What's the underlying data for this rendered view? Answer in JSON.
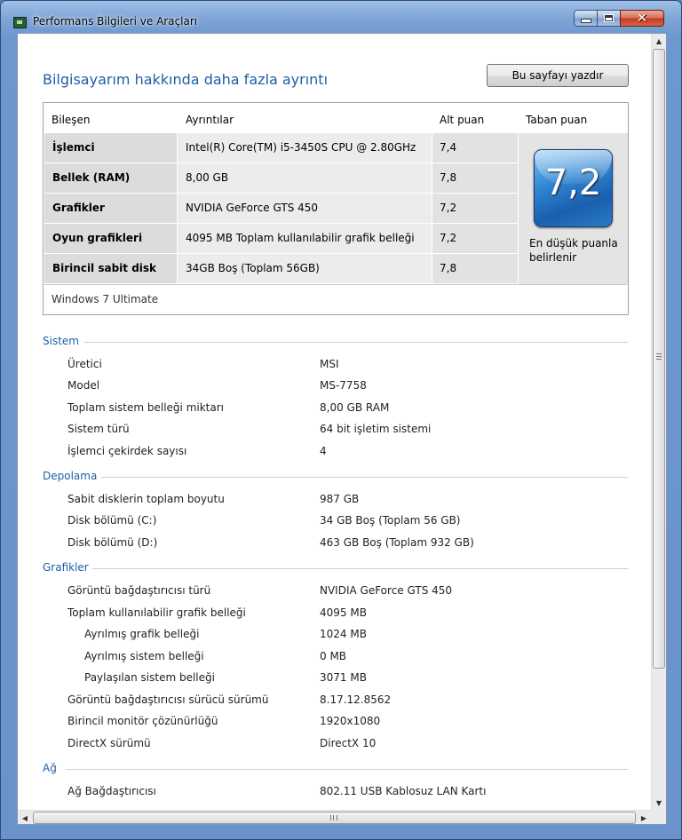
{
  "window": {
    "title": "Performans Bilgileri ve Araçları",
    "close_glyph": "✕"
  },
  "page": {
    "heading": "Bilgisayarım hakkında daha fazla ayrıntı",
    "print_button": "Bu sayfayı yazdır"
  },
  "scores": {
    "headers": {
      "component": "Bileşen",
      "details": "Ayrıntılar",
      "subscore": "Alt puan",
      "base": "Taban puan"
    },
    "rows": [
      {
        "component": "İşlemci",
        "details": "Intel(R) Core(TM) i5-3450S CPU @ 2.80GHz",
        "subscore": "7,4"
      },
      {
        "component": "Bellek (RAM)",
        "details": "8,00 GB",
        "subscore": "7,8"
      },
      {
        "component": "Grafikler",
        "details": "NVIDIA GeForce GTS 450",
        "subscore": "7,2"
      },
      {
        "component": "Oyun grafikleri",
        "details": "4095 MB Toplam kullanılabilir grafik belleği",
        "subscore": "7,2"
      },
      {
        "component": "Birincil sabit disk",
        "details": "34GB Boş (Toplam 56GB)",
        "subscore": "7,8"
      }
    ],
    "base_score": "7,2",
    "base_note": "En düşük puanla belirlenir",
    "os": "Windows 7 Ultimate"
  },
  "sections": {
    "system": {
      "title": "Sistem",
      "items": [
        {
          "label": "Üretici",
          "value": "MSI"
        },
        {
          "label": "Model",
          "value": "MS-7758"
        },
        {
          "label": "Toplam sistem belleği miktarı",
          "value": "8,00 GB RAM"
        },
        {
          "label": "Sistem türü",
          "value": "64 bit işletim sistemi"
        },
        {
          "label": "İşlemci çekirdek sayısı",
          "value": "4"
        }
      ]
    },
    "storage": {
      "title": "Depolama",
      "items": [
        {
          "label": "Sabit disklerin toplam boyutu",
          "value": "987 GB"
        },
        {
          "label": "Disk bölümü (C:)",
          "value": "34 GB Boş (Toplam 56 GB)"
        },
        {
          "label": "Disk bölümü (D:)",
          "value": "463 GB Boş (Toplam 932 GB)"
        }
      ]
    },
    "graphics": {
      "title": "Grafikler",
      "items": [
        {
          "label": "Görüntü bağdaştırıcısı türü",
          "value": "NVIDIA GeForce GTS 450"
        },
        {
          "label": "Toplam kullanılabilir grafik belleği",
          "value": "4095 MB"
        },
        {
          "label": "Ayrılmış grafik belleği",
          "value": "1024 MB"
        },
        {
          "label": "Ayrılmış sistem belleği",
          "value": "0 MB"
        },
        {
          "label": "Paylaşılan sistem belleği",
          "value": "3071 MB"
        },
        {
          "label": "Görüntü bağdaştırıcısı sürücü sürümü",
          "value": "8.17.12.8562"
        },
        {
          "label": "Birincil monitör çözünürlüğü",
          "value": "1920x1080"
        },
        {
          "label": "DirectX sürümü",
          "value": "DirectX 10"
        }
      ]
    },
    "network": {
      "title": "Ağ",
      "items": [
        {
          "label": "Ağ Bağdaştırıcısı",
          "value": "802.11 USB Kablosuz LAN Kartı"
        }
      ]
    }
  },
  "icons": {
    "scroll_up": "▲",
    "scroll_down": "▼",
    "scroll_left": "◀",
    "scroll_right": "▶"
  }
}
